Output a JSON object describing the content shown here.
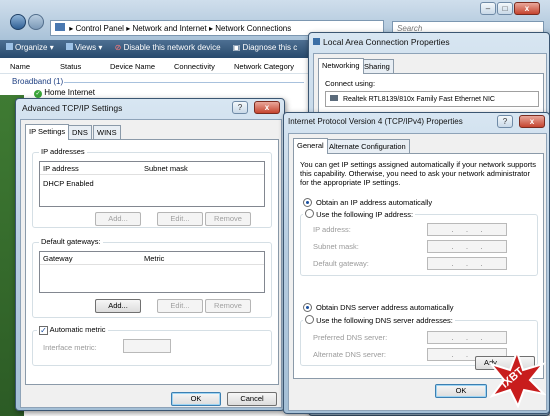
{
  "explorer": {
    "breadcrumb": [
      "Control Panel",
      "Network and Internet",
      "Network Connections"
    ],
    "search_placeholder": "Search",
    "toolbar": [
      "Organize",
      "Views",
      "Disable this network device",
      "Diagnose this c"
    ],
    "columns": [
      "Name",
      "Status",
      "Device Name",
      "Connectivity",
      "Network Category"
    ],
    "group": "Broadband (1)",
    "item": "Home Internet"
  },
  "lac": {
    "title": "Local Area Connection Properties",
    "tabs": [
      "Networking",
      "Sharing"
    ],
    "connect_using": "Connect using:",
    "adapter": "Realtek RTL8139/810x Family Fast Ethernet NIC"
  },
  "adv": {
    "title": "Advanced TCP/IP Settings",
    "tabs": [
      "IP Settings",
      "DNS",
      "WINS"
    ],
    "ip_group": "IP addresses",
    "ip_cols": [
      "IP address",
      "Subnet mask"
    ],
    "ip_row": "DHCP Enabled",
    "gw_group": "Default gateways:",
    "gw_cols": [
      "Gateway",
      "Metric"
    ],
    "add": "Add...",
    "edit": "Edit...",
    "remove": "Remove",
    "auto_metric": "Automatic metric",
    "iface_metric": "Interface metric:",
    "ok": "OK",
    "cancel": "Cancel"
  },
  "ipv4": {
    "title": "Internet Protocol Version 4 (TCP/IPv4) Properties",
    "tabs": [
      "General",
      "Alternate Configuration"
    ],
    "desc": "You can get IP settings assigned automatically if your network supports this capability. Otherwise, you need to ask your network administrator for the appropriate IP settings.",
    "auto_ip": "Obtain an IP address automatically",
    "use_ip": "Use the following IP address:",
    "ip_address": "IP address:",
    "subnet": "Subnet mask:",
    "gateway": "Default gateway:",
    "auto_dns": "Obtain DNS server address automatically",
    "use_dns": "Use the following DNS server addresses:",
    "pref_dns": "Preferred DNS server:",
    "alt_dns": "Alternate DNS server:",
    "advanced": "Adv",
    "ok": "OK",
    "ip_placeholder": ". . ."
  },
  "watermark": "iXBT"
}
